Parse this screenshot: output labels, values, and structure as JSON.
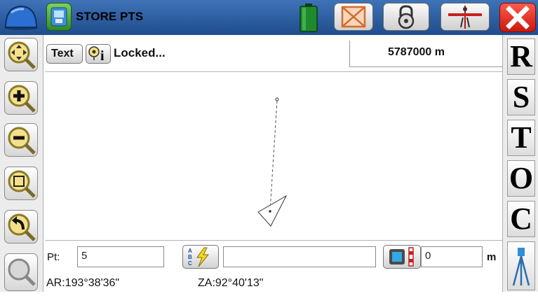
{
  "header": {
    "title": "STORE PTS",
    "icons": [
      "helmet-icon",
      "app-icon",
      "battery-icon",
      "target-icon",
      "lock-icon",
      "rod-icon",
      "close-icon"
    ]
  },
  "toolbar": {
    "text_button": "Text",
    "status": "Locked...",
    "scale": "5787000 m"
  },
  "left_tools": [
    "pan-icon",
    "zoom-in-icon",
    "zoom-out-icon",
    "zoom-window-icon",
    "zoom-previous-icon",
    "zoom-extents-icon"
  ],
  "right_tools": [
    "R",
    "S",
    "T",
    "O",
    "C"
  ],
  "form": {
    "pt_label": "Pt:",
    "pt_value": "5",
    "description_value": "",
    "height_value": "0",
    "height_unit": "m"
  },
  "readouts": {
    "ar": "AR:193°38'36\"",
    "za": "ZA:92°40'13\""
  },
  "colors": {
    "topbar": "#2a5ea3",
    "close": "#e3241b",
    "battery": "#1f8a2c"
  }
}
